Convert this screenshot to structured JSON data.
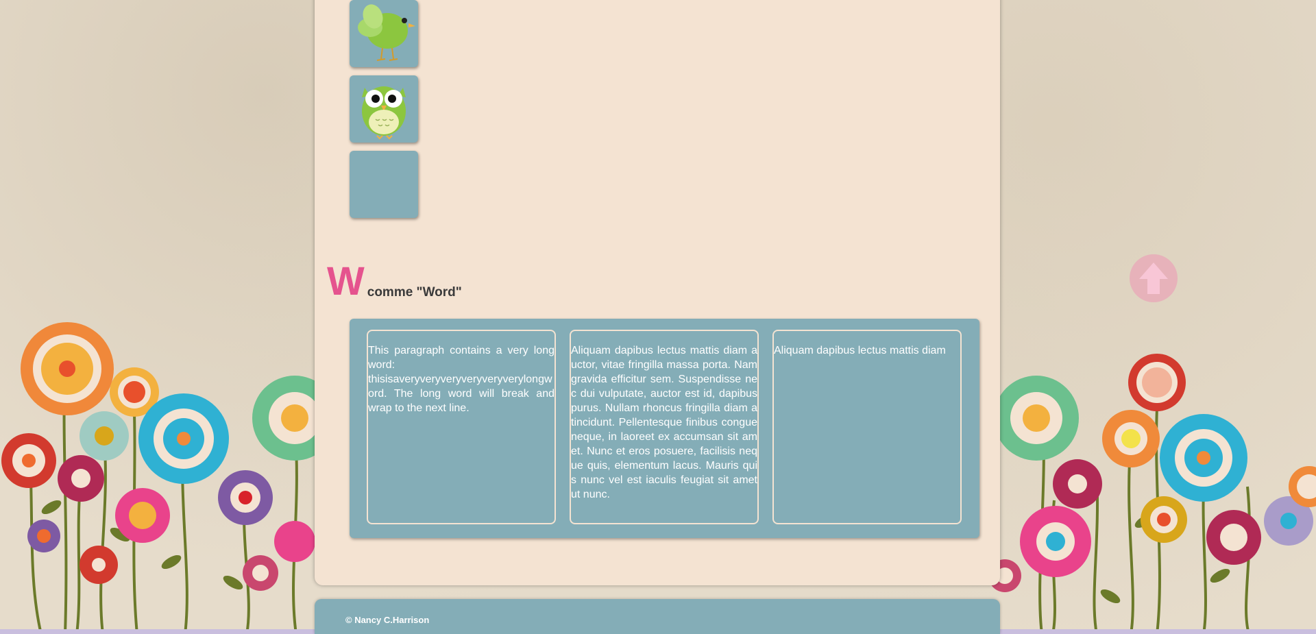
{
  "section": {
    "letter": "W",
    "title": "comme \"Word\""
  },
  "columns": [
    {
      "text": "This paragraph contains a very long word: thisisaveryveryveryveryveryverylongword. The long word will break and wrap to the next line."
    },
    {
      "text": "Aliquam dapibus lectus mattis diam auctor, vitae fringilla massa porta. Nam gravida efficitur sem. Suspendisse nec dui vulputate, auctor est id, dapibus purus. Nullam rhoncus fringilla diam a tincidunt. Pellentesque finibus congue neque, in laoreet ex accumsan sit amet. Nunc et eros posuere, facilisis neque quis, elementum lacus. Mauris quis nunc vel est iaculis feugiat sit amet ut nunc."
    },
    {
      "text": "Aliquam dapibus lectus mattis diam"
    }
  ],
  "thumbnails": [
    {
      "icon": "green-bird-icon"
    },
    {
      "icon": "green-owl-icon"
    },
    {
      "icon": "empty"
    }
  ],
  "footer": {
    "copyright": "© Nancy C.Harrison"
  },
  "colors": {
    "accent": "#e5538e",
    "panel": "#f4e3d2",
    "teal": "#84adb7"
  }
}
